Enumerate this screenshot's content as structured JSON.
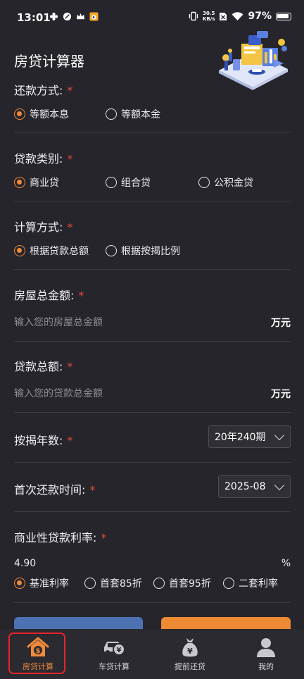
{
  "status_bar": {
    "time": "13:01",
    "net_speed_value": "30.5",
    "net_speed_unit": "KB/s",
    "battery": "97%"
  },
  "page": {
    "title": "房贷计算器"
  },
  "repayment": {
    "label": "还款方式:",
    "required": "*",
    "options": [
      "等额本息",
      "等额本金"
    ],
    "selected": "等额本息"
  },
  "loan_type": {
    "label": "贷款类别:",
    "required": "*",
    "options": [
      "商业贷",
      "组合贷",
      "公积金贷"
    ],
    "selected": "商业贷"
  },
  "calc_method": {
    "label": "计算方式:",
    "required": "*",
    "options": [
      "根据贷款总额",
      "根据按揭比例"
    ],
    "selected": "根据贷款总额"
  },
  "house_total": {
    "label": "房屋总金额:",
    "required": "*",
    "placeholder": "输入您的房屋总金额",
    "value": "",
    "unit": "万元"
  },
  "loan_total": {
    "label": "贷款总额:",
    "required": "*",
    "placeholder": "输入您的贷款总金额",
    "value": "",
    "unit": "万元"
  },
  "mortgage_years": {
    "label": "按揭年数:",
    "required": "*",
    "value": "20年240期"
  },
  "first_payment": {
    "label": "首次还款时间:",
    "required": "*",
    "value": "2025-08"
  },
  "commercial_rate": {
    "label": "商业性贷款利率:",
    "required": "*",
    "value": "4.90",
    "unit": "%",
    "options": [
      "基准利率",
      "首套85折",
      "首套95折",
      "二套利率"
    ],
    "selected": "基准利率"
  },
  "nav": {
    "items": [
      "房贷计算",
      "车贷计算",
      "提前还贷",
      "我的"
    ],
    "active": "房贷计算"
  },
  "colors": {
    "accent": "#f08a3a",
    "required": "#e84a3c",
    "button_blue": "#4d71b3",
    "button_orange": "#ee8a33",
    "highlight_frame": "#e5252b"
  }
}
